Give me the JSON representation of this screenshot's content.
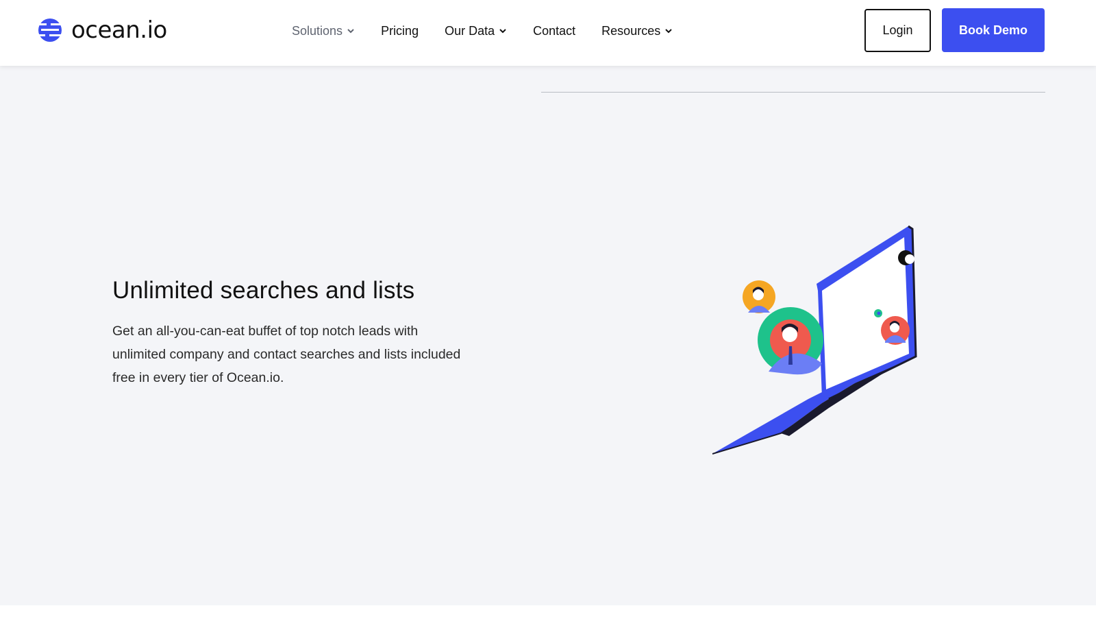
{
  "brand": {
    "name": "ocean",
    "tld": ".io",
    "color": "#3c4ff0"
  },
  "nav": {
    "items": [
      {
        "label": "Solutions",
        "has_dropdown": true
      },
      {
        "label": "Pricing",
        "has_dropdown": false
      },
      {
        "label": "Our Data",
        "has_dropdown": true
      },
      {
        "label": "Contact",
        "has_dropdown": false
      },
      {
        "label": "Resources",
        "has_dropdown": true
      }
    ],
    "login_label": "Login",
    "demo_label": "Book Demo"
  },
  "feature": {
    "title": "Unlimited searches and lists",
    "description": "Get an all-you-can-eat buffet of top notch leads with unlimited company and contact searches and lists included free in every tier of Ocean.io."
  },
  "colors": {
    "accent": "#3c4ff0",
    "section_bg": "#f4f5f8",
    "avatar_orange": "#f5a623",
    "avatar_green": "#1ec28b",
    "avatar_red": "#ef5a4e"
  },
  "icons": {
    "logo": "ocean-logo-icon",
    "dropdown": "chevron-down-icon",
    "illustration": "laptop-contacts-illustration"
  }
}
